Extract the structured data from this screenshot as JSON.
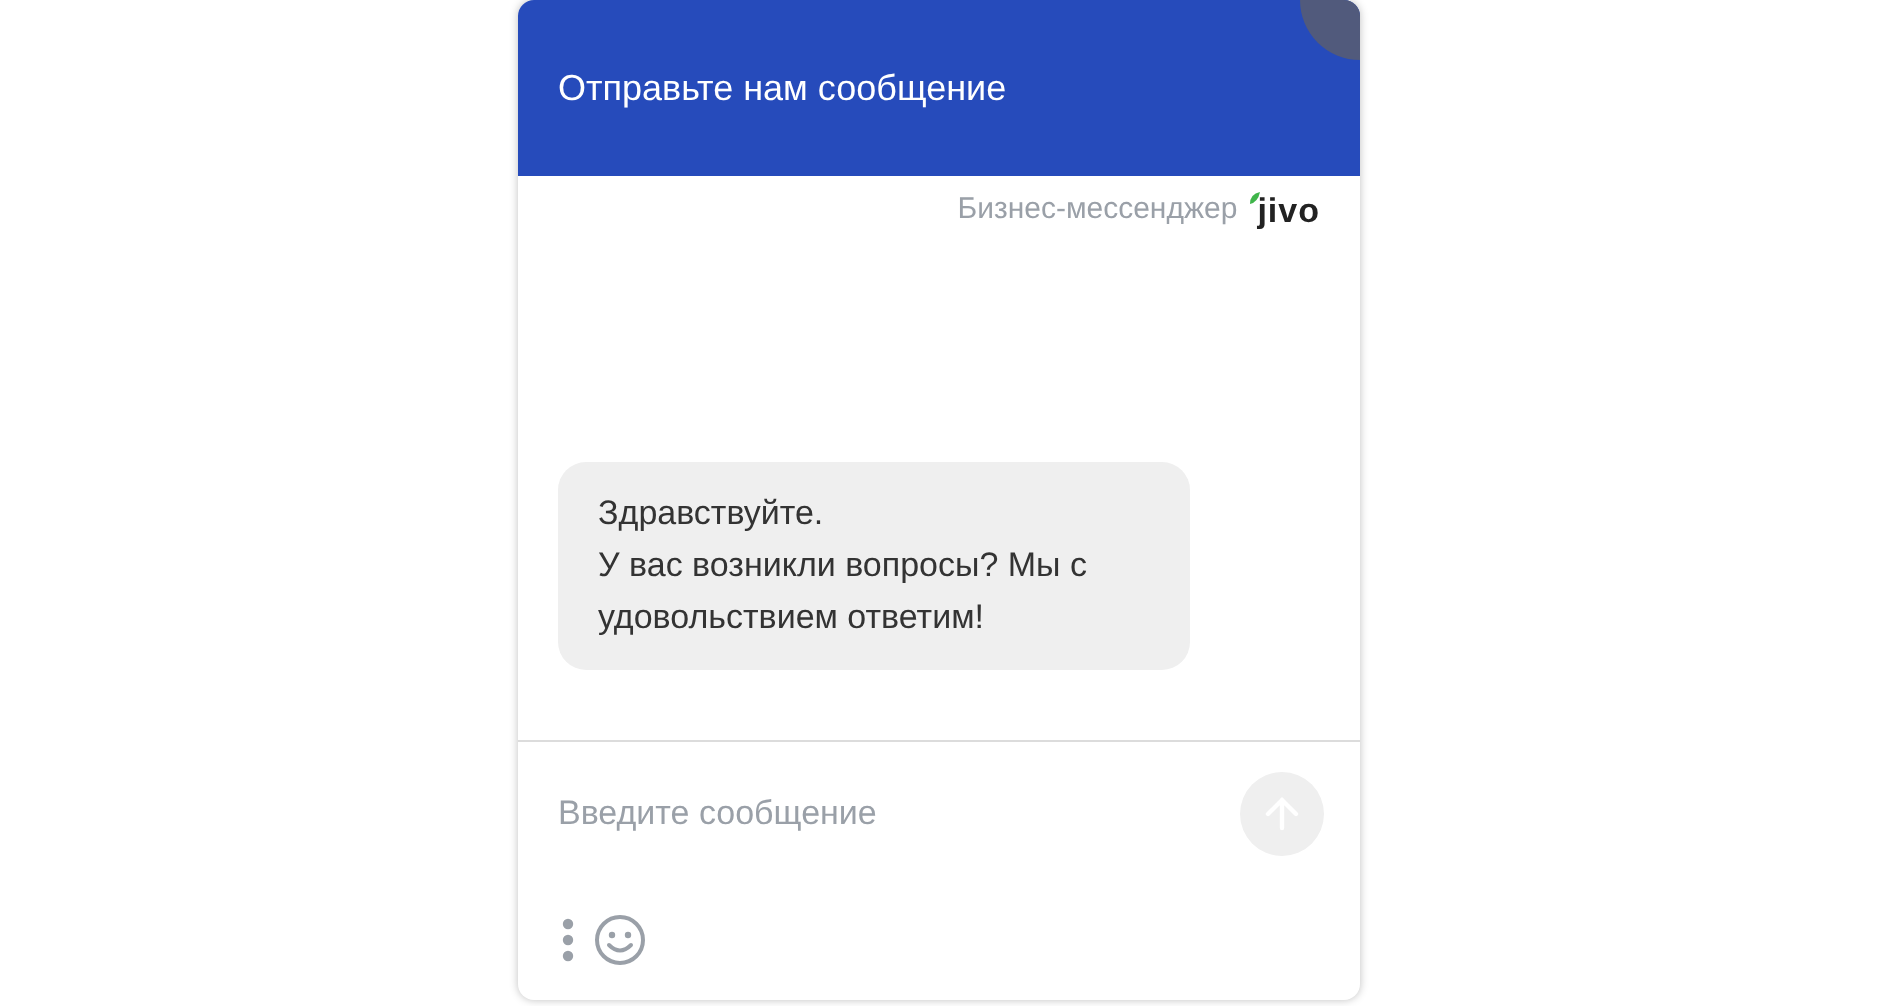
{
  "header": {
    "title": "Отправьте нам сообщение"
  },
  "branding": {
    "caption": "Бизнес-мессенджер",
    "logo": "jivo"
  },
  "messages": [
    {
      "lines": [
        "Здравствуйте.",
        "У вас возникли вопросы? Мы с удовольствием ответим!"
      ]
    }
  ],
  "composer": {
    "placeholder": "Введите сообщение"
  }
}
